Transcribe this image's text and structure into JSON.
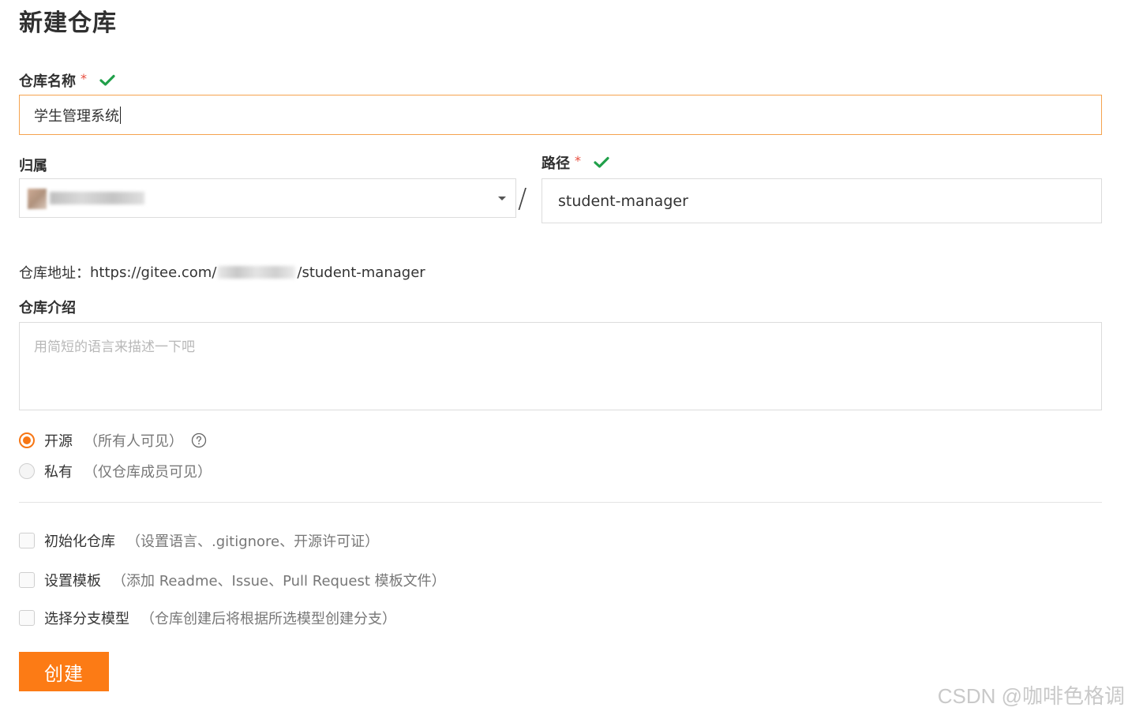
{
  "page_title": "新建仓库",
  "repo_name": {
    "label": "仓库名称",
    "required_mark": "*",
    "value": "学生管理系统",
    "valid": true
  },
  "owner": {
    "label": "归属"
  },
  "path": {
    "label": "路径",
    "required_mark": "*",
    "separator": "/",
    "value": "student-manager",
    "valid": true
  },
  "repo_url": {
    "label": "仓库地址：",
    "prefix": "https://gitee.com/",
    "suffix": "/student-manager"
  },
  "description": {
    "label": "仓库介绍",
    "placeholder": "用简短的语言来描述一下吧"
  },
  "visibility": {
    "options": [
      {
        "label": "开源",
        "hint": "（所有人可见）",
        "checked": true
      },
      {
        "label": "私有",
        "hint": "（仅仓库成员可见）",
        "checked": false
      }
    ]
  },
  "extras": [
    {
      "label": "初始化仓库",
      "hint": "（设置语言、.gitignore、开源许可证）",
      "checked": false
    },
    {
      "label": "设置模板",
      "hint": "（添加 Readme、Issue、Pull Request 模板文件）",
      "checked": false
    },
    {
      "label": "选择分支模型",
      "hint": "（仓库创建后将根据所选模型创建分支）",
      "checked": false
    }
  ],
  "create_button": "创建",
  "watermark": "CSDN @咖啡色格调",
  "colors": {
    "accent": "#fc7b15",
    "valid": "#21a04a",
    "required": "#e84c3d",
    "focus_border": "#f5a34f"
  },
  "icons": {
    "valid": "check-icon",
    "help": "question-circle-icon",
    "dropdown": "caret-down-icon"
  }
}
